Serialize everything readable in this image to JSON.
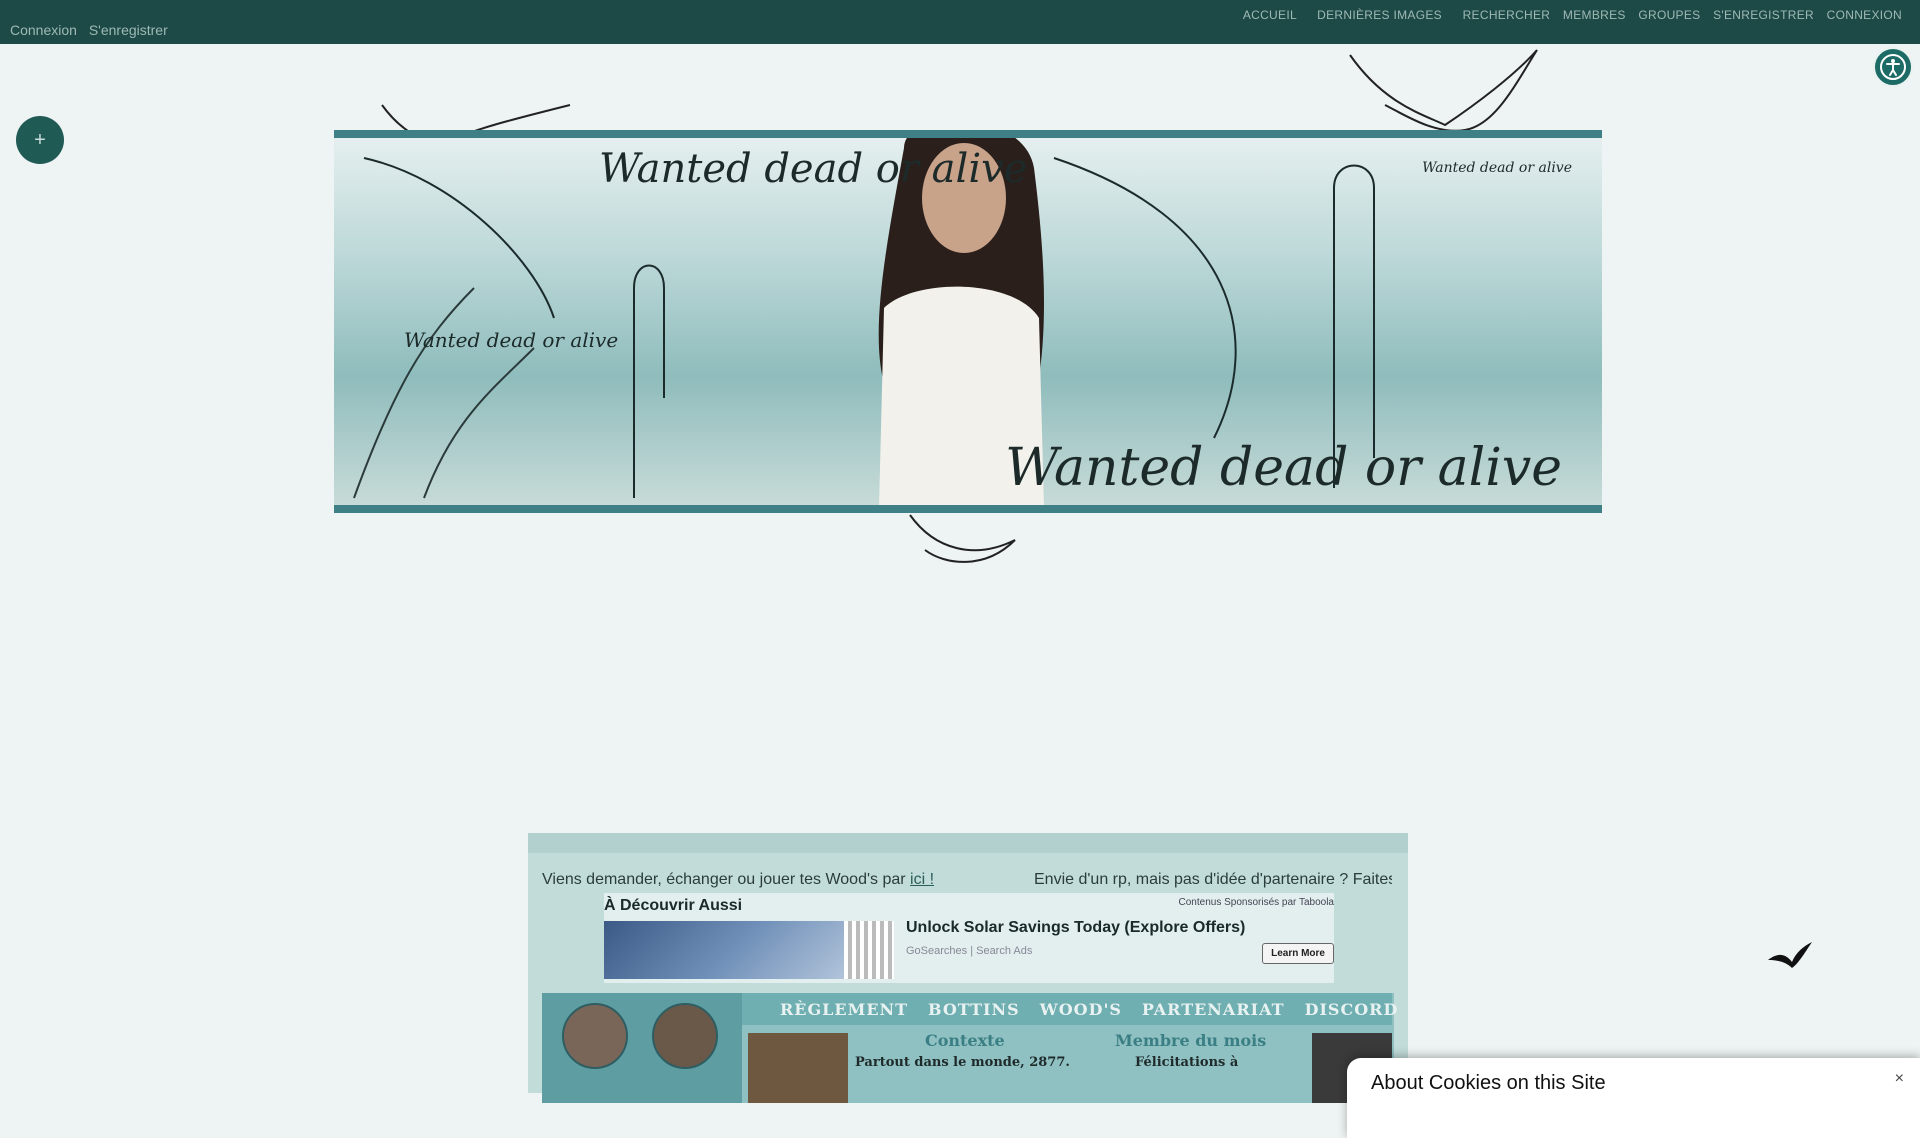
{
  "topbar": {
    "left_links": [
      "Connexion",
      "S'enregistrer"
    ],
    "nav": [
      "ACCUEIL",
      "DERNIÈRES IMAGES",
      "RECHERCHER",
      "MEMBRES",
      "GROUPES",
      "S'ENREGISTRER",
      "CONNEXION"
    ]
  },
  "widgets": {
    "accessibility_icon": "accessibility-icon",
    "plus_label": "+"
  },
  "banner": {
    "caption_main": "Wanted dead or alive",
    "caption_small_left": "Wanted dead or alive",
    "caption_small_right": "Wanted dead or alive",
    "caption_bottom": "Wanted dead or alive"
  },
  "content": {
    "marquee_left_prefix": "Viens demander, échanger ou jouer tes Wood's par ",
    "marquee_left_link": "ici !",
    "marquee_right": "Envie d'un rp, mais pas d'idée d'partenaire ? Faites"
  },
  "ad": {
    "title": "À Découvrir Aussi",
    "sponsor": "Contenus Sponsorisés par Taboola",
    "headline": "Unlock Solar Savings Today (Explore Offers)",
    "source": "GoSearches | Search Ads",
    "cta": "Learn More"
  },
  "forum": {
    "tabs": [
      "RÈGLEMENT",
      "BOTTINS",
      "WOOD'S",
      "PARTENARIAT",
      "DISCORD"
    ],
    "contexte_title": "Contexte",
    "contexte_text": "Partout dans le monde, 2877.",
    "membre_title": "Membre du mois",
    "membre_text": "Félicitations à"
  },
  "cookie": {
    "title": "About Cookies on this Site",
    "close": "×"
  },
  "colors": {
    "topbar": "#1d4a46",
    "accent": "#3f7f86",
    "background": "#eef4f3"
  }
}
